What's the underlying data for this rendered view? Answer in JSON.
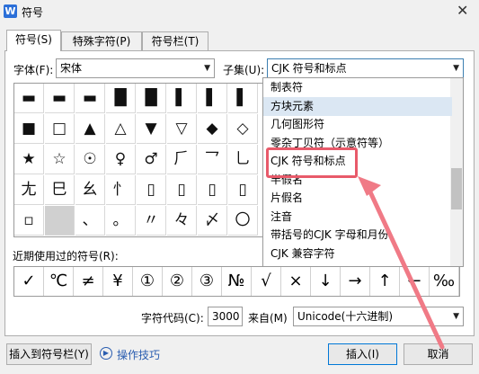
{
  "window": {
    "title": "符号",
    "app_icon_letter": "W",
    "close_glyph": "✕"
  },
  "tabs": [
    "符号(S)",
    "特殊字符(P)",
    "符号栏(T)"
  ],
  "font": {
    "label": "字体(F):",
    "value": "宋体"
  },
  "subset": {
    "label": "子集(U):",
    "value": "CJK 符号和标点"
  },
  "grid": [
    [
      "▬",
      "▬",
      "▬",
      "█",
      "█",
      "▌",
      "▌",
      "▌"
    ],
    [
      "■",
      "□",
      "▲",
      "△",
      "▼",
      "▽",
      "◆",
      "◇"
    ],
    [
      "★",
      "☆",
      "☉",
      "♀",
      "♂",
      "⺁",
      "⺂",
      "⺃"
    ],
    [
      "⺐",
      "⺒",
      "⺓",
      "⺖",
      "▯",
      "▯",
      "▯",
      "▯"
    ],
    [
      "▫",
      "",
      "、",
      "。",
      "〃",
      "々",
      "〆",
      "〇"
    ]
  ],
  "subset_list": [
    "制表符",
    "方块元素",
    "几何图形符",
    "零杂丁贝符（示意符等）",
    "CJK 符号和标点",
    "半假名",
    "片假名",
    "注音",
    "带括号的CJK 字母和月份",
    "CJK 兼容字符"
  ],
  "subset_list_highlight": 1,
  "recent": {
    "label": "近期使用过的符号(R):",
    "symbols": [
      "✓",
      "℃",
      "≠",
      "¥",
      "①",
      "②",
      "③",
      "№",
      "√",
      "×",
      "↓",
      "→",
      "↑",
      "←",
      "‰"
    ]
  },
  "code": {
    "label": "字符代码(C):",
    "value": "3000",
    "from_label": "来自(M)",
    "from_value": "Unicode(十六进制)"
  },
  "buttons": {
    "insert_to_bar": "插入到符号栏(Y)",
    "tips": "操作技巧",
    "insert": "插入(I)",
    "cancel": "取消"
  },
  "colors": {
    "highlight_box": "#e85a6a",
    "arrow": "#f07a86",
    "link": "#2a5db0"
  }
}
